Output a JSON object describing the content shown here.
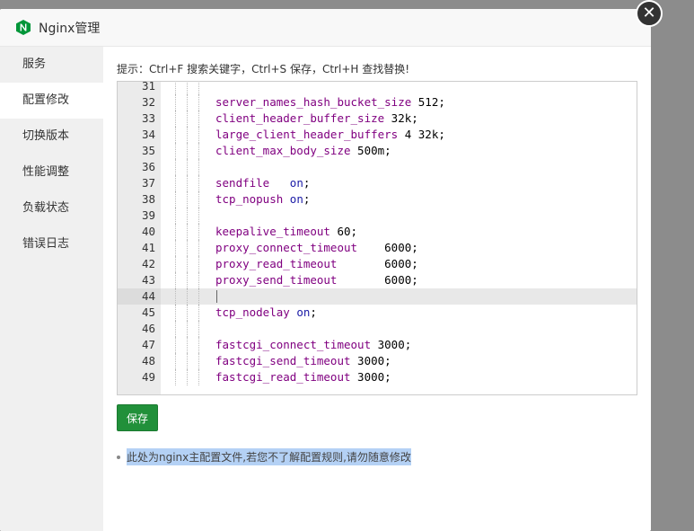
{
  "window": {
    "title": "Nginx管理"
  },
  "sidebar": {
    "items": [
      {
        "label": "服务"
      },
      {
        "label": "配置修改",
        "active": true
      },
      {
        "label": "切换版本"
      },
      {
        "label": "性能调整"
      },
      {
        "label": "负载状态"
      },
      {
        "label": "错误日志"
      }
    ]
  },
  "main": {
    "hint": "提示：Ctrl+F 搜索关键字，Ctrl+S 保存，Ctrl+H 查找替换!",
    "save_label": "保存",
    "note": "此处为nginx主配置文件,若您不了解配置规则,请勿随意修改"
  },
  "editor": {
    "current_line": 44,
    "lines": [
      {
        "n": "31",
        "key": "",
        "val": ""
      },
      {
        "n": "32",
        "key": "server_names_hash_bucket_size",
        "val": " 512;"
      },
      {
        "n": "33",
        "key": "client_header_buffer_size",
        "val": " 32k;"
      },
      {
        "n": "34",
        "key": "large_client_header_buffers",
        "val": " 4 32k;"
      },
      {
        "n": "35",
        "key": "client_max_body_size",
        "val": " 500m;"
      },
      {
        "n": "36",
        "key": "",
        "val": ""
      },
      {
        "n": "37",
        "key": "sendfile",
        "val": "   on;"
      },
      {
        "n": "38",
        "key": "tcp_nopush",
        "val": " on;"
      },
      {
        "n": "39",
        "key": "",
        "val": ""
      },
      {
        "n": "40",
        "key": "keepalive_timeout",
        "val": " 60;"
      },
      {
        "n": "41",
        "key": "proxy_connect_timeout",
        "val": "    6000;"
      },
      {
        "n": "42",
        "key": "proxy_read_timeout",
        "val": "       6000;"
      },
      {
        "n": "43",
        "key": "proxy_send_timeout",
        "val": "       6000;"
      },
      {
        "n": "44",
        "key": "",
        "val": ""
      },
      {
        "n": "45",
        "key": "tcp_nodelay",
        "val": " on;"
      },
      {
        "n": "46",
        "key": "",
        "val": ""
      },
      {
        "n": "47",
        "key": "fastcgi_connect_timeout",
        "val": " 3000;"
      },
      {
        "n": "48",
        "key": "fastcgi_send_timeout",
        "val": " 3000;"
      },
      {
        "n": "49",
        "key": "fastcgi_read_timeout",
        "val": " 3000;"
      }
    ]
  },
  "colors": {
    "accent": "#21903a",
    "keyword": "#800080",
    "boolean": "#1a1aa6"
  },
  "icons": {
    "logo": "nginx-logo-icon",
    "close": "close-icon"
  }
}
